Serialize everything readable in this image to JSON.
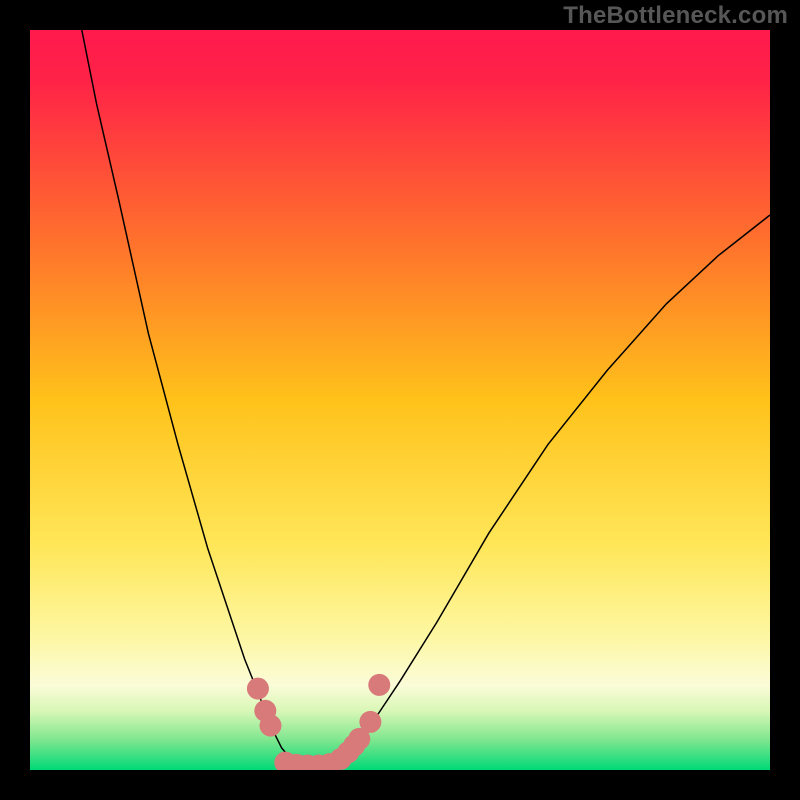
{
  "watermark": {
    "text": "TheBottleneck.com"
  },
  "chart_data": {
    "type": "line",
    "title": "",
    "xlabel": "",
    "ylabel": "",
    "xlim": [
      0,
      100
    ],
    "ylim": [
      0,
      100
    ],
    "grid": false,
    "legend": false,
    "background_gradient": {
      "stops": [
        {
          "offset": 0.0,
          "color": "#ff1a4d"
        },
        {
          "offset": 0.07,
          "color": "#ff2347"
        },
        {
          "offset": 0.28,
          "color": "#ff6f2d"
        },
        {
          "offset": 0.5,
          "color": "#ffc21a"
        },
        {
          "offset": 0.7,
          "color": "#ffe75a"
        },
        {
          "offset": 0.82,
          "color": "#fdf7a3"
        },
        {
          "offset": 0.885,
          "color": "#fbfcd8"
        },
        {
          "offset": 0.92,
          "color": "#d9f7b6"
        },
        {
          "offset": 0.96,
          "color": "#7de68e"
        },
        {
          "offset": 1.0,
          "color": "#00d977"
        }
      ]
    },
    "series": [
      {
        "name": "bottleneck-curve",
        "color": "#000000",
        "stroke_width": 1.5,
        "points": [
          {
            "x": 7.0,
            "y": 100.0
          },
          {
            "x": 9.0,
            "y": 90.0
          },
          {
            "x": 12.0,
            "y": 77.0
          },
          {
            "x": 16.0,
            "y": 59.0
          },
          {
            "x": 20.0,
            "y": 44.0
          },
          {
            "x": 24.0,
            "y": 30.0
          },
          {
            "x": 27.0,
            "y": 21.0
          },
          {
            "x": 29.0,
            "y": 15.0
          },
          {
            "x": 31.0,
            "y": 10.0
          },
          {
            "x": 32.5,
            "y": 6.0
          },
          {
            "x": 34.0,
            "y": 3.0
          },
          {
            "x": 35.5,
            "y": 1.2
          },
          {
            "x": 37.0,
            "y": 0.5
          },
          {
            "x": 39.0,
            "y": 0.5
          },
          {
            "x": 41.0,
            "y": 1.0
          },
          {
            "x": 42.5,
            "y": 2.0
          },
          {
            "x": 44.0,
            "y": 3.5
          },
          {
            "x": 46.0,
            "y": 6.0
          },
          {
            "x": 50.0,
            "y": 12.0
          },
          {
            "x": 55.0,
            "y": 20.0
          },
          {
            "x": 62.0,
            "y": 32.0
          },
          {
            "x": 70.0,
            "y": 44.0
          },
          {
            "x": 78.0,
            "y": 54.0
          },
          {
            "x": 86.0,
            "y": 63.0
          },
          {
            "x": 93.0,
            "y": 69.5
          },
          {
            "x": 100.0,
            "y": 75.0
          }
        ]
      }
    ],
    "markers": {
      "name": "highlight-dots",
      "color": "#d87a7a",
      "radius": 11,
      "points": [
        {
          "x": 30.8,
          "y": 11.0
        },
        {
          "x": 31.8,
          "y": 8.0
        },
        {
          "x": 32.5,
          "y": 6.0
        },
        {
          "x": 34.5,
          "y": 1.0
        },
        {
          "x": 36.0,
          "y": 0.7
        },
        {
          "x": 37.5,
          "y": 0.6
        },
        {
          "x": 39.0,
          "y": 0.6
        },
        {
          "x": 40.5,
          "y": 0.8
        },
        {
          "x": 42.0,
          "y": 1.5
        },
        {
          "x": 43.0,
          "y": 2.4
        },
        {
          "x": 43.8,
          "y": 3.3
        },
        {
          "x": 44.5,
          "y": 4.2
        },
        {
          "x": 46.0,
          "y": 6.5
        },
        {
          "x": 47.2,
          "y": 11.5
        }
      ]
    }
  }
}
